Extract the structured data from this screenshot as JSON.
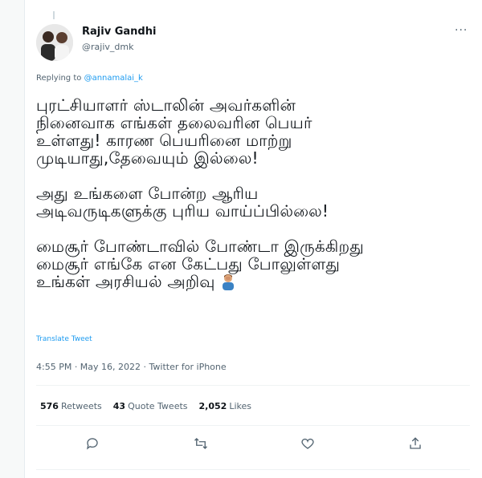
{
  "tweet": {
    "author_name": "Rajiv Gandhi",
    "author_handle": "@rajiv_dmk",
    "more_label": "···",
    "replying_prefix": "Replying to ",
    "replying_to": "@annamalai_k",
    "paragraphs": [
      [
        "புரட்சியாளர் ஸ்டாலின் அவர்களின்",
        "நினைவாக எங்கள் தலைவரின பெயர்",
        "உள்ளது! காரண பெயரினை மாற்று",
        "முடியாது,தேவையும் இல்லை!"
      ],
      [
        "அது உங்களை போன்ற ஆரிய",
        "அடிவருடிகளுக்கு புரிய வாய்ப்பில்லை!"
      ],
      [
        "மைசூர் போண்டாவில் போண்டா இருக்கிறது",
        "மைசூர் எங்கே என கேட்பது போலுள்ளது",
        "உங்கள் அரசியல் அறிவு"
      ]
    ],
    "emoji": "person-facepalming-emoji",
    "translate_label": "Translate Tweet",
    "timestamp": "4:55 PM · May 16, 2022 · Twitter for iPhone"
  },
  "stats": {
    "retweets_count": "576",
    "retweets_label": "Retweets",
    "quotes_count": "43",
    "quotes_label": "Quote Tweets",
    "likes_count": "2,052",
    "likes_label": "Likes"
  },
  "actions": [
    "reply-icon",
    "retweet-icon",
    "like-icon",
    "share-icon"
  ],
  "colors": {
    "link": "#1d9bf0",
    "muted": "#536471",
    "text": "#0f1419"
  }
}
